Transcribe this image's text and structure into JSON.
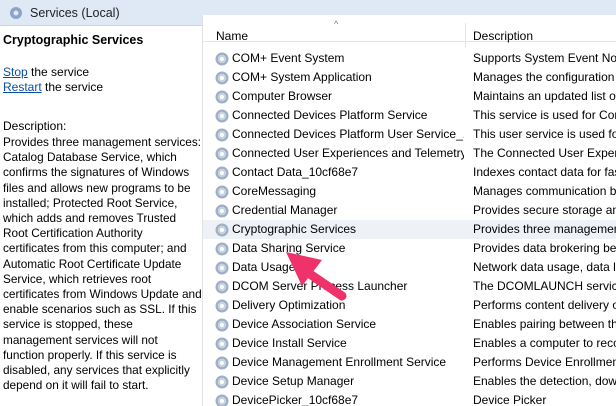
{
  "window": {
    "title": "Services (Local)"
  },
  "detail": {
    "service_name": "Cryptographic Services",
    "stop_link": "Stop",
    "stop_suffix": " the service",
    "restart_link": "Restart",
    "restart_suffix": " the service",
    "description_label": "Description:",
    "description_text": "Provides three management services: Catalog Database Service, which confirms the signatures of Windows files and allows new programs to be installed; Protected Root Service, which adds and removes Trusted Root Certification Authority certificates from this computer; and Automatic Root Certificate Update Service, which retrieves root certificates from Windows Update and enable scenarios such as SSL. If this service is stopped, these management services will not function properly. If this service is disabled, any services that explicitly depend on it will fail to start."
  },
  "list": {
    "columns": {
      "name": "Name",
      "description": "Description",
      "sort_indicator": "^"
    },
    "rows": [
      {
        "name": "COM+ Event System",
        "description": "Supports System Event Noti"
      },
      {
        "name": "COM+ System Application",
        "description": "Manages the configuration"
      },
      {
        "name": "Computer Browser",
        "description": "Maintains an updated list o"
      },
      {
        "name": "Connected Devices Platform Service",
        "description": "This service is used for Con"
      },
      {
        "name": "Connected Devices Platform User Service_...",
        "description": "This user service is used fo"
      },
      {
        "name": "Connected User Experiences and Telemetry",
        "description": "The Connected User Experie"
      },
      {
        "name": "Contact Data_10cf68e7",
        "description": "Indexes contact data for fas"
      },
      {
        "name": "CoreMessaging",
        "description": "Manages communication b"
      },
      {
        "name": "Credential Manager",
        "description": "Provides secure storage and"
      },
      {
        "name": "Cryptographic Services",
        "description": "Provides three managemen"
      },
      {
        "name": "Data Sharing Service",
        "description": "Provides data brokering bet"
      },
      {
        "name": "Data Usage",
        "description": "Network data usage, data li"
      },
      {
        "name": "DCOM Server Process Launcher",
        "description": "The DCOMLAUNCH service"
      },
      {
        "name": "Delivery Optimization",
        "description": "Performs content delivery o"
      },
      {
        "name": "Device Association Service",
        "description": "Enables pairing between th"
      },
      {
        "name": "Device Install Service",
        "description": "Enables a computer to reco"
      },
      {
        "name": "Device Management Enrollment Service",
        "description": "Performs Device Enrollmen"
      },
      {
        "name": "Device Setup Manager",
        "description": "Enables the detection, dow"
      },
      {
        "name": "DevicePicker_10cf68e7",
        "description": "Device Picker"
      }
    ],
    "selected_index": 9
  },
  "colors": {
    "link": "#0b4fa3",
    "pointer": "#f0326a",
    "selected_row": "#eef1f6"
  },
  "icons": {
    "window": "gear-icon",
    "service": "gear-icon"
  }
}
